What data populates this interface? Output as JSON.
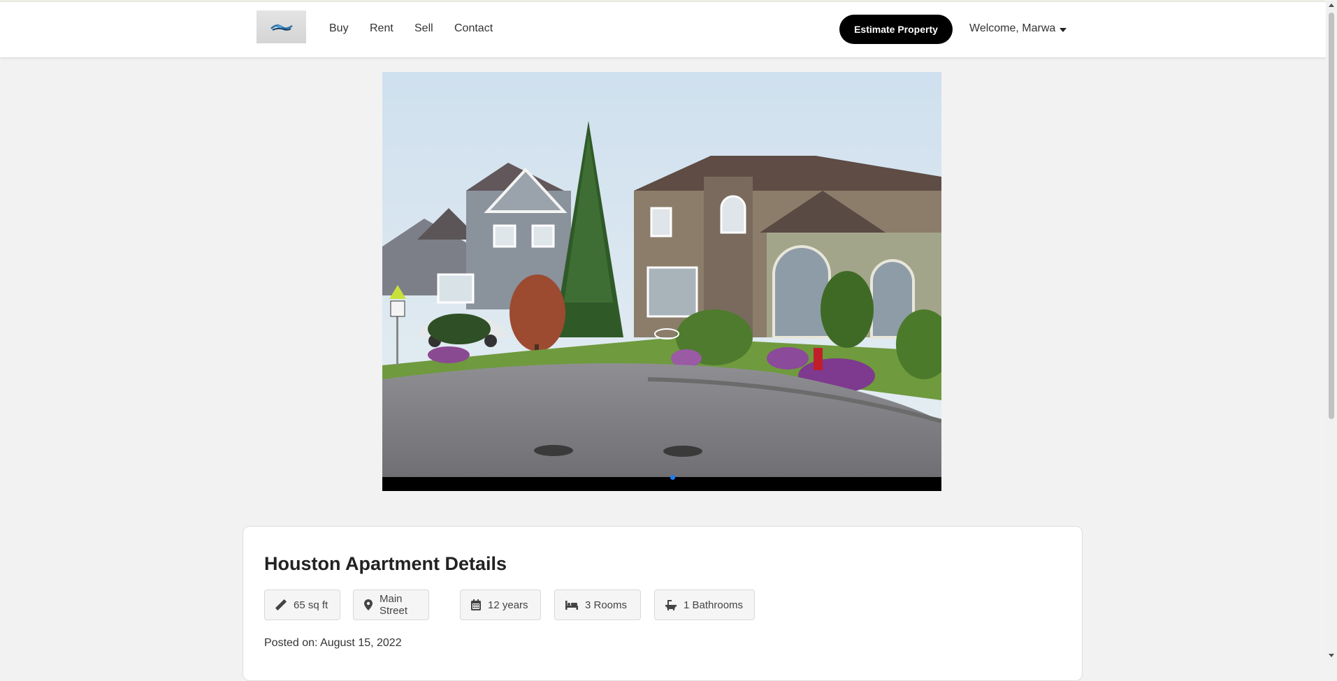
{
  "header": {
    "logo_alt": "logo",
    "nav": [
      "Buy",
      "Rent",
      "Sell",
      "Contact"
    ],
    "estimate_button": "Estimate Property",
    "welcome": "Welcome, Marwa"
  },
  "carousel": {
    "active_slide": 1,
    "slide_count": 1
  },
  "listing": {
    "title": "Houston Apartment Details",
    "features": [
      {
        "icon": "ruler-icon",
        "label": "65 sq ft"
      },
      {
        "icon": "map-pin-icon",
        "label": "Main Street"
      },
      {
        "icon": "calendar-icon",
        "label": "12 years"
      },
      {
        "icon": "bed-icon",
        "label": "3 Rooms"
      },
      {
        "icon": "bath-icon",
        "label": "1 Bathrooms"
      }
    ],
    "posted": "Posted on: August 15, 2022"
  },
  "colors": {
    "accent_button": "#000000",
    "carousel_dot": "#1e7cf2",
    "page_bg": "#f2f2f2"
  }
}
